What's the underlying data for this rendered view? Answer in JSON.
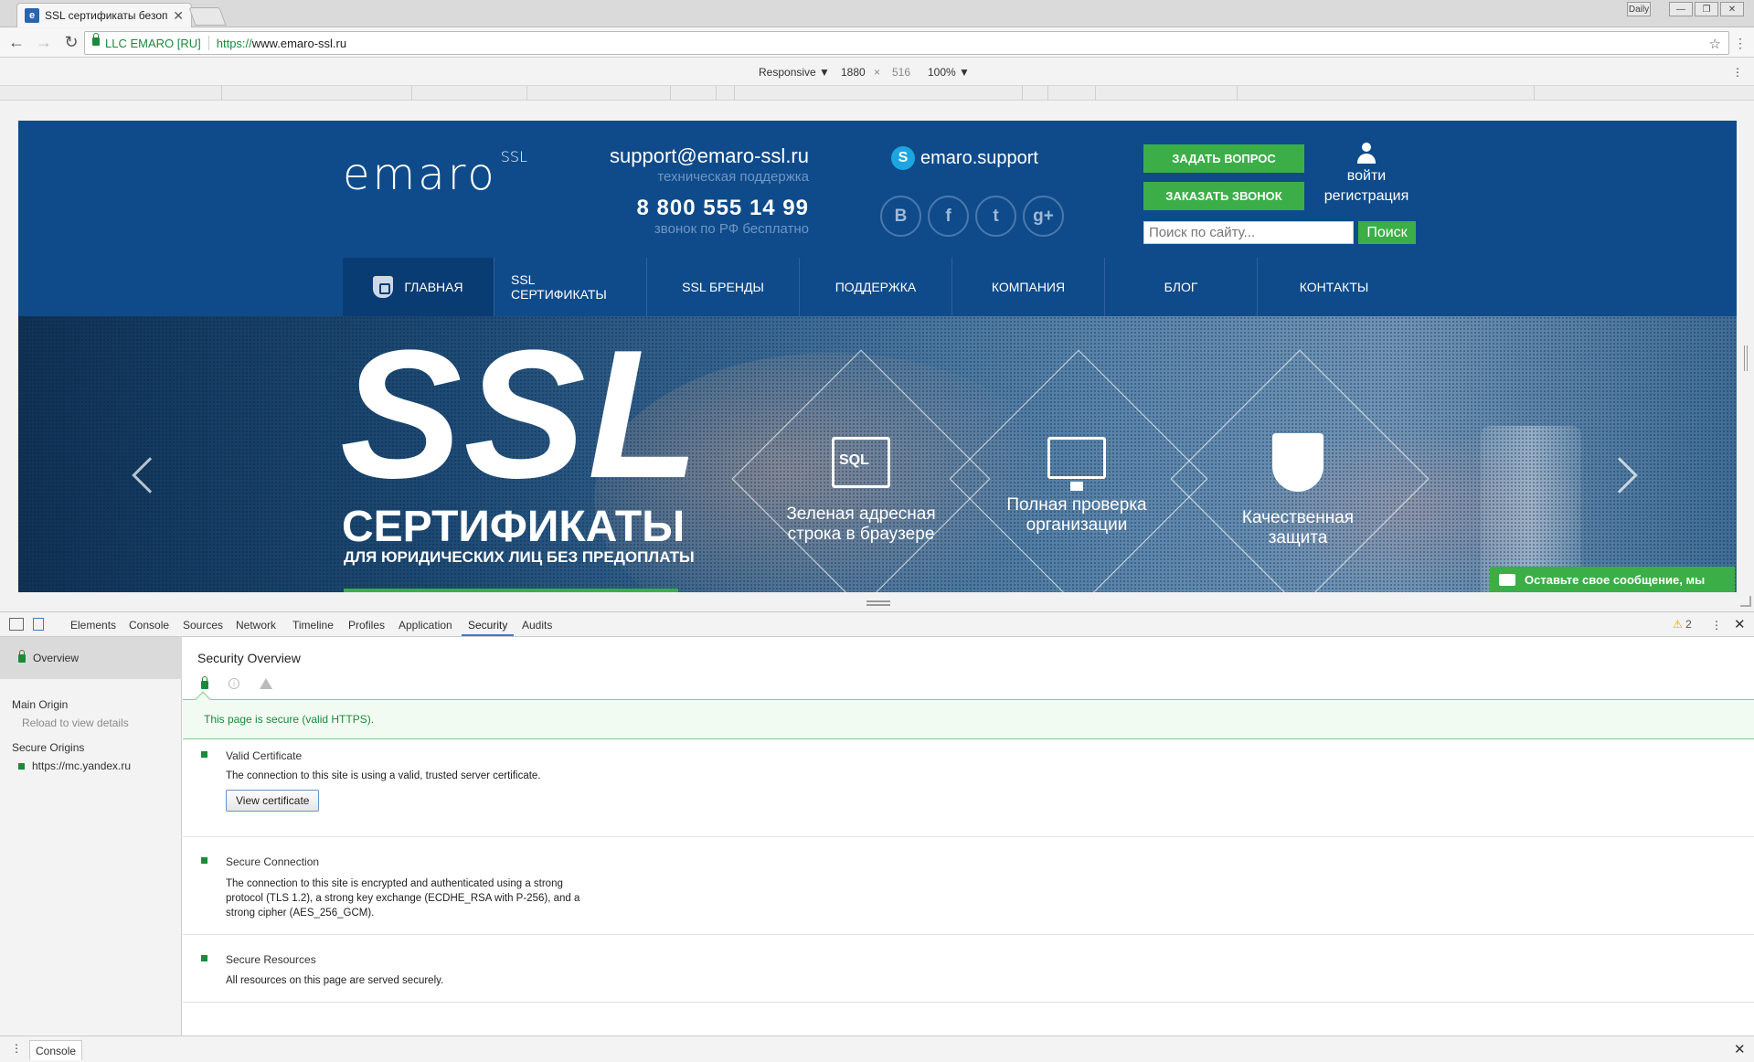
{
  "browser": {
    "tab_title": "SSL сертификаты безоп",
    "tab_close": "✕",
    "favicon_letter": "e",
    "url_org": "LLC EMARO [RU]",
    "url_scheme": "https://",
    "url_host": "www.emaro-ssl.ru",
    "window_controls": [
      "—",
      "❐",
      "✕"
    ],
    "profile_button": "Daily"
  },
  "device_toolbar": {
    "mode": "Responsive ▼",
    "width": "1880",
    "times": "×",
    "height": "516",
    "zoom": "100% ▼"
  },
  "site": {
    "logo_text": "emaro",
    "logo_sup": "SSL",
    "email": "support@emaro-ssl.ru",
    "email_sub": "техническая поддержка",
    "phone": "8 800 555 14 99",
    "phone_sub": "звонок по РФ бесплатно",
    "skype_letter": "S",
    "skype": "emaro.support",
    "socials": [
      "B",
      "f",
      "t",
      "g+"
    ],
    "ask_button": "ЗАДАТЬ ВОПРОС",
    "call_button": "ЗАКАЗАТЬ ЗВОНОК",
    "login": "войти",
    "register": "регистрация",
    "search_placeholder": "Поиск по сайту...",
    "search_button": "Поиск",
    "nav": [
      "ГЛАВНАЯ",
      "SSL СЕРТИФИКАТЫ",
      "SSL БРЕНДЫ",
      "ПОДДЕРЖКА",
      "КОМПАНИЯ",
      "БЛОГ",
      "КОНТАКТЫ"
    ],
    "hero": {
      "big": "SSL",
      "title": "СЕРТИФИКАТЫ",
      "subtitle": "ДЛЯ ЮРИДИЧЕСКИХ ЛИЦ БЕЗ ПРЕДОПЛАТЫ",
      "sql_label": "SQL",
      "features": [
        {
          "line1": "Зеленая адресная",
          "line2": "строка в браузере"
        },
        {
          "line1": "Полная проверка",
          "line2": "организации"
        },
        {
          "line1": "Качественная",
          "line2": "защита"
        }
      ]
    },
    "chat_widget": "Оставьте свое сообщение, мы"
  },
  "devtools": {
    "tabs": [
      "Elements",
      "Console",
      "Sources",
      "Network",
      "Timeline",
      "Profiles",
      "Application",
      "Security",
      "Audits"
    ],
    "active_tab": "Security",
    "warnings_count": "2",
    "warn_glyph": "⚠",
    "kebab": "⋮",
    "close": "✕",
    "sidebar": {
      "overview": "Overview",
      "main_origin": "Main Origin",
      "reload_hint": "Reload to view details",
      "secure_origins": "Secure Origins",
      "origin_url": "https://mc.yandex.ru"
    },
    "main": {
      "title": "Security Overview",
      "info_glyph": "i",
      "secure_banner": "This page is secure (valid HTTPS).",
      "sections": [
        {
          "title": "Valid Certificate",
          "desc": "The connection to this site is using a valid, trusted server certificate.",
          "button": "View certificate"
        },
        {
          "title": "Secure Connection",
          "desc": "The connection to this site is encrypted and authenticated using a strong protocol (TLS 1.2), a strong key exchange (ECDHE_RSA with P-256), and a strong cipher (AES_256_GCM)."
        },
        {
          "title": "Secure Resources",
          "desc": "All resources on this page are served securely."
        }
      ]
    },
    "drawer_tab": "Console"
  }
}
